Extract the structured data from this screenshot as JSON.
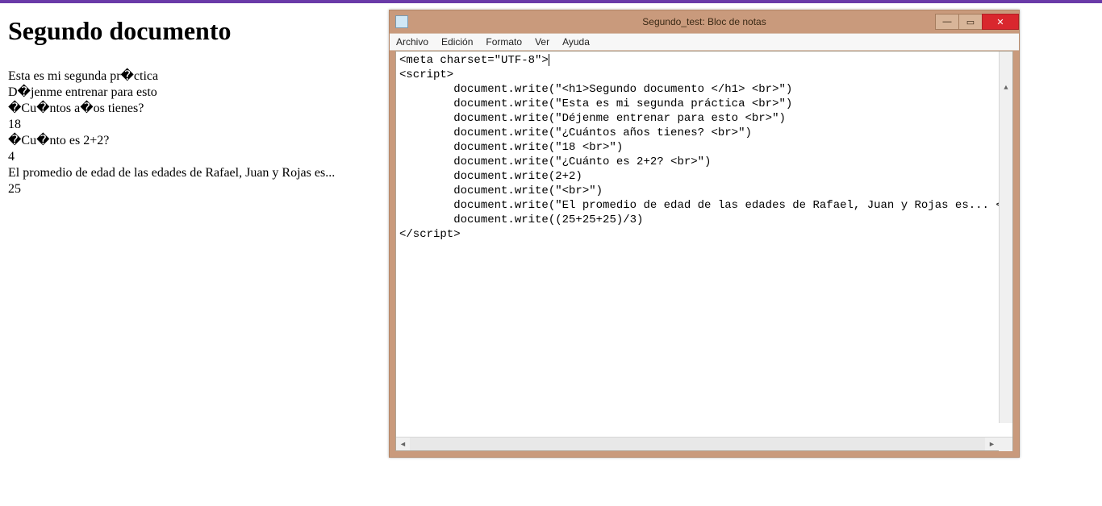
{
  "browser": {
    "heading": "Segundo documento",
    "lines": [
      "Esta es mi segunda pr�ctica",
      "D�jenme entrenar para esto",
      "�Cu�ntos a�os tienes?",
      "18",
      "�Cu�nto es 2+2?",
      "4",
      "El promedio de edad de las edades de Rafael, Juan y Rojas es...",
      "25"
    ]
  },
  "notepad": {
    "title": "Segundo_test: Bloc de notas",
    "menu": {
      "file": "Archivo",
      "edit": "Edición",
      "format": "Formato",
      "view": "Ver",
      "help": "Ayuda"
    },
    "code_lines": [
      "<meta charset=\"UTF-8\">",
      "<script>",
      "        document.write(\"<h1>Segundo documento </h1> <br>\")",
      "        document.write(\"Esta es mi segunda práctica <br>\")",
      "        document.write(\"Déjenme entrenar para esto <br>\")",
      "        document.write(\"¿Cuántos años tienes? <br>\")",
      "        document.write(\"18 <br>\")",
      "        document.write(\"¿Cuánto es 2+2? <br>\")",
      "        document.write(2+2)",
      "        document.write(\"<br>\")",
      "        document.write(\"El promedio de edad de las edades de Rafael, Juan y Rojas es... <br>\")",
      "        document.write((25+25+25)/3)",
      "</script>"
    ],
    "window_controls": {
      "minimize": "—",
      "maximize": "▭",
      "close": "✕"
    }
  }
}
